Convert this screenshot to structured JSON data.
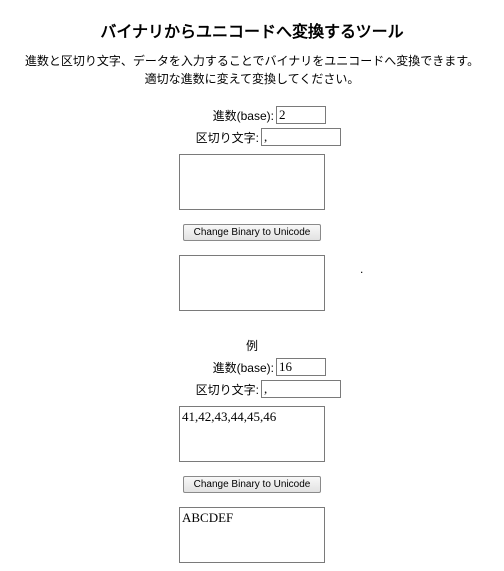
{
  "page": {
    "title": "バイナリからユニコードへ変換するツール",
    "desc_line1": "進数と区切り文字、データを入力することでバイナリをユニコードへ変換できます。",
    "desc_line2": "適切な進数に変えて変換してください。"
  },
  "form1": {
    "base_label": "進数(base):",
    "base_value": "2",
    "delim_label": "区切り文字:",
    "delim_value": ",",
    "input_text": "",
    "button_label": "Change Binary to Unicode",
    "output_text": ""
  },
  "example": {
    "heading": "例",
    "base_label": "進数(base):",
    "base_value": "16",
    "delim_label": "区切り文字:",
    "delim_value": ",",
    "input_text": "41,42,43,44,45,46",
    "button_label": "Change Binary to Unicode",
    "output_text": "ABCDEF"
  },
  "stray_dot": "."
}
